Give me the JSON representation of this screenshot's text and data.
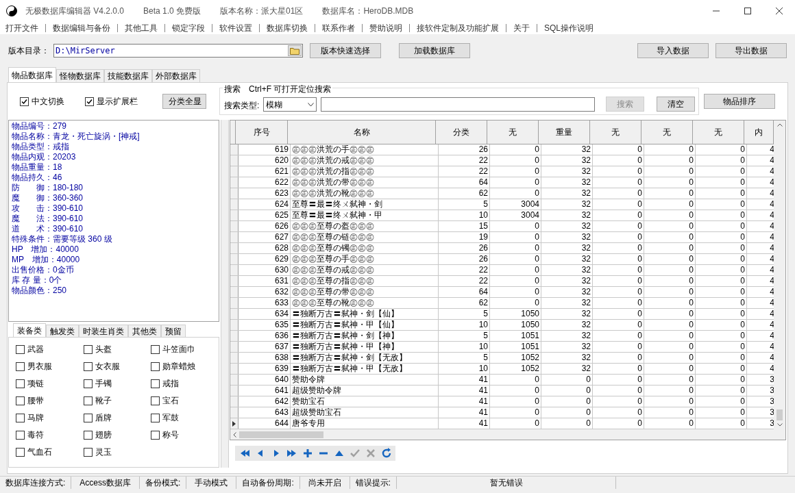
{
  "window": {
    "title": "无极数据库编辑器 V4.2.0.0",
    "edition": "Beta 1.0 免费版",
    "version_name": "版本名称：派大星01区",
    "database_name": "数据库名：HeroDB.MDB"
  },
  "menu": [
    "打开文件",
    "数据编辑与备份",
    "其他工具",
    "锁定字段",
    "软件设置",
    "数据库切换",
    "联系作者",
    "赞助说明",
    "接软件定制及功能扩展",
    "关于",
    "SQL操作说明"
  ],
  "toolbar": {
    "dir_label": "版本目录：",
    "dir_value": "D:\\MirServer",
    "buttons": [
      "版本快速选择",
      "加载数据库"
    ],
    "right_buttons": [
      "导入数据",
      "导出数据"
    ]
  },
  "tabs": [
    {
      "label": "物品数据库",
      "selected": true
    },
    {
      "label": "怪物数据库",
      "selected": false
    },
    {
      "label": "技能数据库",
      "selected": false
    },
    {
      "label": "外部数据库",
      "selected": false
    }
  ],
  "options": [
    {
      "label": "中文切换",
      "checked": true
    },
    {
      "label": "显示扩展栏",
      "checked": true
    }
  ],
  "show_all_button": "分类全显",
  "search": {
    "title": "搜索　Ctrl+F 可打开定位搜索",
    "type_label": "搜索类型:",
    "type_value": "模糊",
    "button": "搜索",
    "button_disabled": true,
    "clear": "清空"
  },
  "sort_button": "物品排序",
  "info": [
    "物品编号：279",
    "物品名称：青龙・死亡旋涡・[神戒]",
    "物品类型：戒指",
    "物品内观：20203",
    "物品重量：18",
    "物品持久：46",
    "防　　御：180-180",
    "魔　　御：360-360",
    "攻　　击：390-610",
    "魔　　法：390-610",
    "道　　术：390-610",
    "特殊条件：需要等级 360 级",
    "HP　增加：40000",
    "MP　增加：40000",
    "出售价格：0金币",
    "库 存 量：0个",
    "物品颜色：250"
  ],
  "category_tabs": [
    {
      "label": "装备类",
      "selected": true
    },
    {
      "label": "触发类",
      "selected": false
    },
    {
      "label": "时装生肖类",
      "selected": false
    },
    {
      "label": "其他类",
      "selected": false
    },
    {
      "label": "预留",
      "selected": false
    }
  ],
  "categories": [
    {
      "label": "武器",
      "checked": false
    },
    {
      "label": "头盔",
      "checked": false
    },
    {
      "label": "斗笠面巾",
      "checked": false
    },
    {
      "label": "男衣服",
      "checked": false
    },
    {
      "label": "女衣服",
      "checked": false
    },
    {
      "label": "勋章蜡烛",
      "checked": false
    },
    {
      "label": "项链",
      "checked": false
    },
    {
      "label": "手镯",
      "checked": false
    },
    {
      "label": "戒指",
      "checked": false
    },
    {
      "label": "腰带",
      "checked": false
    },
    {
      "label": "靴子",
      "checked": false
    },
    {
      "label": "宝石",
      "checked": false
    },
    {
      "label": "马牌",
      "checked": false
    },
    {
      "label": "盾牌",
      "checked": false
    },
    {
      "label": "军鼓",
      "checked": false
    },
    {
      "label": "毒符",
      "checked": false
    },
    {
      "label": "翅膀",
      "checked": false
    },
    {
      "label": "称号",
      "checked": false
    },
    {
      "label": "气血石",
      "checked": false
    },
    {
      "label": "灵玉",
      "checked": false
    }
  ],
  "table": {
    "columns": [
      "序号",
      "名称",
      "分类",
      "无",
      "重量",
      "无",
      "无",
      "无",
      "内"
    ],
    "rows": [
      {
        "current": false,
        "cells": [
          "619",
          "㊣㊣㊣洪荒の手㊣㊣㊣",
          "26",
          "0",
          "32",
          "0",
          "0",
          "0",
          "4"
        ]
      },
      {
        "current": false,
        "cells": [
          "620",
          "㊣㊣㊣洪荒の戒㊣㊣㊣",
          "22",
          "0",
          "32",
          "0",
          "0",
          "0",
          "4"
        ]
      },
      {
        "current": false,
        "cells": [
          "621",
          "㊣㊣㊣洪荒の指㊣㊣㊣",
          "22",
          "0",
          "32",
          "0",
          "0",
          "0",
          "4"
        ]
      },
      {
        "current": false,
        "cells": [
          "622",
          "㊣㊣㊣洪荒の带㊣㊣㊣",
          "64",
          "0",
          "32",
          "0",
          "0",
          "0",
          "4"
        ]
      },
      {
        "current": false,
        "cells": [
          "623",
          "㊣㊣㊣洪荒の靴㊣㊣㊣",
          "62",
          "0",
          "32",
          "0",
          "0",
          "0",
          "4"
        ]
      },
      {
        "current": false,
        "cells": [
          "624",
          "至尊〓最〓终ㄨ弑神・剑",
          "5",
          "3004",
          "32",
          "0",
          "0",
          "0",
          "4"
        ]
      },
      {
        "current": false,
        "cells": [
          "625",
          "至尊〓最〓终ㄨ弑神・甲",
          "10",
          "3004",
          "32",
          "0",
          "0",
          "0",
          "4"
        ]
      },
      {
        "current": false,
        "cells": [
          "626",
          "㊣㊣㊣至尊の盔㊣㊣㊣",
          "15",
          "0",
          "32",
          "0",
          "0",
          "0",
          "4"
        ]
      },
      {
        "current": false,
        "cells": [
          "627",
          "㊣㊣㊣至尊の链㊣㊣㊣",
          "19",
          "0",
          "32",
          "0",
          "0",
          "0",
          "4"
        ]
      },
      {
        "current": false,
        "cells": [
          "628",
          "㊣㊣㊣至尊の镯㊣㊣㊣",
          "26",
          "0",
          "32",
          "0",
          "0",
          "0",
          "4"
        ]
      },
      {
        "current": false,
        "cells": [
          "629",
          "㊣㊣㊣至尊の手㊣㊣㊣",
          "26",
          "0",
          "32",
          "0",
          "0",
          "0",
          "4"
        ]
      },
      {
        "current": false,
        "cells": [
          "630",
          "㊣㊣㊣至尊の戒㊣㊣㊣",
          "22",
          "0",
          "32",
          "0",
          "0",
          "0",
          "4"
        ]
      },
      {
        "current": false,
        "cells": [
          "631",
          "㊣㊣㊣至尊の指㊣㊣㊣",
          "22",
          "0",
          "32",
          "0",
          "0",
          "0",
          "4"
        ]
      },
      {
        "current": false,
        "cells": [
          "632",
          "㊣㊣㊣至尊の带㊣㊣㊣",
          "64",
          "0",
          "32",
          "0",
          "0",
          "0",
          "4"
        ]
      },
      {
        "current": false,
        "cells": [
          "633",
          "㊣㊣㊣至尊の靴㊣㊣㊣",
          "62",
          "0",
          "32",
          "0",
          "0",
          "0",
          "4"
        ]
      },
      {
        "current": false,
        "cells": [
          "634",
          "〓独断万古〓弑神・剑【仙】",
          "5",
          "1050",
          "32",
          "0",
          "0",
          "0",
          "4"
        ]
      },
      {
        "current": false,
        "cells": [
          "635",
          "〓独断万古〓弑神・甲【仙】",
          "10",
          "1050",
          "32",
          "0",
          "0",
          "0",
          "4"
        ]
      },
      {
        "current": false,
        "cells": [
          "636",
          "〓独断万古〓弑神・剑【神】",
          "5",
          "1051",
          "32",
          "0",
          "0",
          "0",
          "4"
        ]
      },
      {
        "current": false,
        "cells": [
          "637",
          "〓独断万古〓弑神・甲【神】",
          "10",
          "1051",
          "32",
          "0",
          "0",
          "0",
          "4"
        ]
      },
      {
        "current": false,
        "cells": [
          "638",
          "〓独断万古〓弑神・剑【无敌】",
          "5",
          "1052",
          "32",
          "0",
          "0",
          "0",
          "4"
        ]
      },
      {
        "current": false,
        "cells": [
          "639",
          "〓独断万古〓弑神・甲【无敌】",
          "10",
          "1052",
          "32",
          "0",
          "0",
          "0",
          "4"
        ]
      },
      {
        "current": false,
        "cells": [
          "640",
          "赞助令牌",
          "41",
          "0",
          "0",
          "0",
          "0",
          "0",
          "3"
        ]
      },
      {
        "current": false,
        "cells": [
          "641",
          "超级赞助令牌",
          "41",
          "0",
          "0",
          "0",
          "0",
          "0",
          "3"
        ]
      },
      {
        "current": false,
        "cells": [
          "642",
          "赞助宝石",
          "41",
          "0",
          "0",
          "0",
          "0",
          "0",
          "3"
        ]
      },
      {
        "current": false,
        "cells": [
          "643",
          "超级赞助宝石",
          "41",
          "0",
          "0",
          "0",
          "0",
          "0",
          "3"
        ]
      },
      {
        "current": true,
        "cells": [
          "644",
          "唐爷专用",
          "41",
          "0",
          "0",
          "0",
          "0",
          "0",
          "3"
        ]
      }
    ]
  },
  "navigator": [
    {
      "kind": "first",
      "disabled": false
    },
    {
      "kind": "prior",
      "disabled": false
    },
    {
      "kind": "next",
      "disabled": false
    },
    {
      "kind": "last",
      "disabled": false
    },
    {
      "kind": "insert",
      "disabled": false
    },
    {
      "kind": "delete",
      "disabled": false
    },
    {
      "kind": "edit",
      "disabled": false
    },
    {
      "kind": "post",
      "disabled": true
    },
    {
      "kind": "cancel",
      "disabled": true
    },
    {
      "kind": "refresh",
      "disabled": false
    }
  ],
  "status_bar": [
    {
      "label": "数据库连接方式:",
      "value": "Access数据库"
    },
    {
      "label": "备份模式:",
      "value": "手动模式"
    },
    {
      "label": "自动备份周期:",
      "value": "尚未开启"
    },
    {
      "label": "错误提示:",
      "value": "暂无错误"
    }
  ]
}
